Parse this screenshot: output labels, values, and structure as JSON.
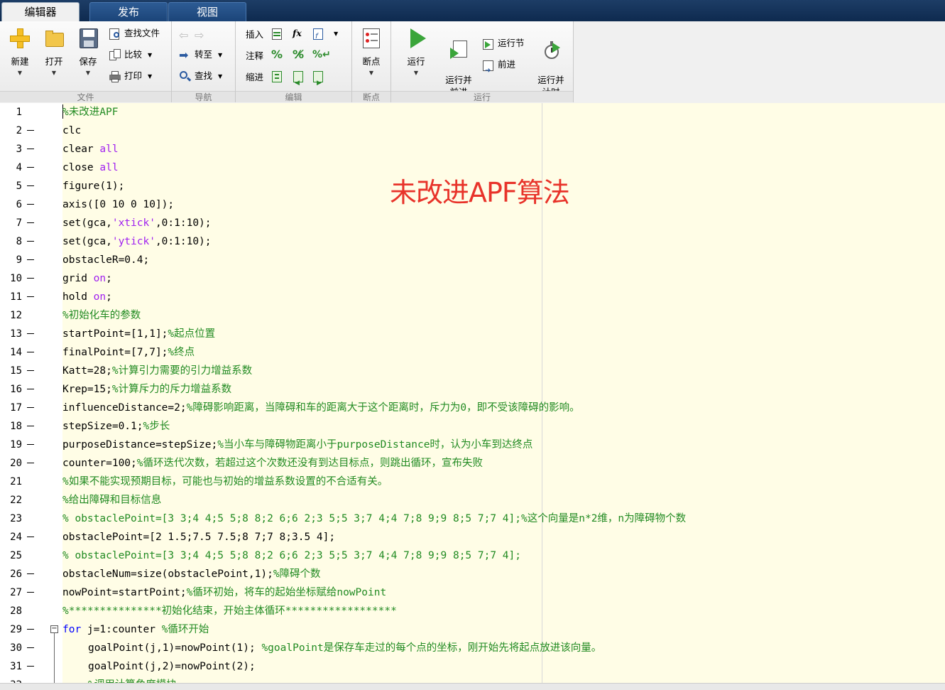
{
  "tabs": [
    {
      "label": "编辑器",
      "active": true
    },
    {
      "label": "发布",
      "active": false
    },
    {
      "label": "视图",
      "active": false
    }
  ],
  "ribbon": {
    "file_group": {
      "label": "文件",
      "new": "新建",
      "open": "打开",
      "save": "保存",
      "find_file": "查找文件",
      "compare": "比较",
      "print": "打印"
    },
    "nav_group": {
      "label": "导航",
      "goto": "转至",
      "find": "查找"
    },
    "edit_group": {
      "label": "编辑",
      "insert": "插入",
      "comment": "注释",
      "indent": "缩进"
    },
    "breakpoint_group": {
      "label": "断点",
      "breakpoints": "断点"
    },
    "run_group": {
      "label": "运行",
      "run": "运行",
      "run_advance": "运行并\n前进",
      "run_section": "运行节",
      "advance": "前进",
      "run_time": "运行并\n计时"
    }
  },
  "overlay_title": "未改进APF算法",
  "lines": [
    {
      "n": "1",
      "dash": false,
      "parts": [
        {
          "t": "%未改进APF",
          "c": "cmt"
        }
      ]
    },
    {
      "n": "2",
      "dash": true,
      "parts": [
        {
          "t": "clc",
          "c": ""
        }
      ]
    },
    {
      "n": "3",
      "dash": true,
      "parts": [
        {
          "t": "clear ",
          "c": ""
        },
        {
          "t": "all",
          "c": "str"
        }
      ]
    },
    {
      "n": "4",
      "dash": true,
      "parts": [
        {
          "t": "close ",
          "c": ""
        },
        {
          "t": "all",
          "c": "str"
        }
      ]
    },
    {
      "n": "5",
      "dash": true,
      "parts": [
        {
          "t": "figure(1);",
          "c": ""
        }
      ]
    },
    {
      "n": "6",
      "dash": true,
      "parts": [
        {
          "t": "axis([0 10 0 10]);",
          "c": ""
        }
      ]
    },
    {
      "n": "7",
      "dash": true,
      "parts": [
        {
          "t": "set(gca,",
          "c": ""
        },
        {
          "t": "'xtick'",
          "c": "str"
        },
        {
          "t": ",0:1:10);",
          "c": ""
        }
      ]
    },
    {
      "n": "8",
      "dash": true,
      "parts": [
        {
          "t": "set(gca,",
          "c": ""
        },
        {
          "t": "'ytick'",
          "c": "str"
        },
        {
          "t": ",0:1:10);",
          "c": ""
        }
      ]
    },
    {
      "n": "9",
      "dash": true,
      "parts": [
        {
          "t": "obstacleR=0.4;",
          "c": ""
        }
      ]
    },
    {
      "n": "10",
      "dash": true,
      "parts": [
        {
          "t": "grid ",
          "c": ""
        },
        {
          "t": "on",
          "c": "str"
        },
        {
          "t": ";",
          "c": ""
        }
      ]
    },
    {
      "n": "11",
      "dash": true,
      "parts": [
        {
          "t": "hold ",
          "c": ""
        },
        {
          "t": "on",
          "c": "str"
        },
        {
          "t": ";",
          "c": ""
        }
      ]
    },
    {
      "n": "12",
      "dash": false,
      "parts": [
        {
          "t": "%初始化车的参数",
          "c": "cmt"
        }
      ]
    },
    {
      "n": "13",
      "dash": true,
      "parts": [
        {
          "t": "startPoint=[1,1];",
          "c": ""
        },
        {
          "t": "%起点位置",
          "c": "cmt"
        }
      ]
    },
    {
      "n": "14",
      "dash": true,
      "parts": [
        {
          "t": "finalPoint=[7,7];",
          "c": ""
        },
        {
          "t": "%终点",
          "c": "cmt"
        }
      ]
    },
    {
      "n": "15",
      "dash": true,
      "parts": [
        {
          "t": "Katt=28;",
          "c": ""
        },
        {
          "t": "%计算引力需要的引力增益系数",
          "c": "cmt"
        }
      ]
    },
    {
      "n": "16",
      "dash": true,
      "parts": [
        {
          "t": "Krep=15;",
          "c": ""
        },
        {
          "t": "%计算斥力的斥力增益系数",
          "c": "cmt"
        }
      ]
    },
    {
      "n": "17",
      "dash": true,
      "parts": [
        {
          "t": "influenceDistance=2;",
          "c": ""
        },
        {
          "t": "%障碍影响距离，当障碍和车的距离大于这个距离时，斥力为0，即不受该障碍的影响。",
          "c": "cmt"
        }
      ]
    },
    {
      "n": "18",
      "dash": true,
      "parts": [
        {
          "t": "stepSize=0.1;",
          "c": ""
        },
        {
          "t": "%步长",
          "c": "cmt"
        }
      ]
    },
    {
      "n": "19",
      "dash": true,
      "parts": [
        {
          "t": "purposeDistance=stepSize;",
          "c": ""
        },
        {
          "t": "%当小车与障碍物距离小于purposeDistance时，认为小车到达终点",
          "c": "cmt"
        }
      ]
    },
    {
      "n": "20",
      "dash": true,
      "parts": [
        {
          "t": "counter=100;",
          "c": ""
        },
        {
          "t": "%循环迭代次数，若超过这个次数还没有到达目标点，则跳出循环，宣布失败",
          "c": "cmt"
        }
      ]
    },
    {
      "n": "21",
      "dash": false,
      "parts": [
        {
          "t": "%如果不能实现预期目标，可能也与初始的增益系数设置的不合适有关。",
          "c": "cmt"
        }
      ]
    },
    {
      "n": "22",
      "dash": false,
      "parts": [
        {
          "t": "%给出障碍和目标信息",
          "c": "cmt"
        }
      ]
    },
    {
      "n": "23",
      "dash": false,
      "parts": [
        {
          "t": "% obstaclePoint=[3 3;4 4;5 5;8 8;2 6;6 2;3 5;5 3;7 4;4 7;8 9;9 8;5 7;7 4];%这个向量是n*2维，n为障碍物个数",
          "c": "cmt"
        }
      ]
    },
    {
      "n": "24",
      "dash": true,
      "parts": [
        {
          "t": "obstaclePoint=[2 1.5;7.5 7.5;8 7;7 8;3.5 4];",
          "c": ""
        }
      ]
    },
    {
      "n": "25",
      "dash": false,
      "parts": [
        {
          "t": "% obstaclePoint=[3 3;4 4;5 5;8 8;2 6;6 2;3 5;5 3;7 4;4 7;8 9;9 8;5 7;7 4];",
          "c": "cmt"
        }
      ]
    },
    {
      "n": "26",
      "dash": true,
      "parts": [
        {
          "t": "obstacleNum=size(obstaclePoint,1);",
          "c": ""
        },
        {
          "t": "%障碍个数",
          "c": "cmt"
        }
      ]
    },
    {
      "n": "27",
      "dash": true,
      "parts": [
        {
          "t": "nowPoint=startPoint;",
          "c": ""
        },
        {
          "t": "%循环初始，将车的起始坐标赋给nowPoint",
          "c": "cmt"
        }
      ]
    },
    {
      "n": "28",
      "dash": false,
      "parts": [
        {
          "t": "%***************初始化结束，开始主体循环******************",
          "c": "cmt"
        }
      ]
    },
    {
      "n": "29",
      "dash": true,
      "fold": true,
      "parts": [
        {
          "t": "for",
          "c": "kw"
        },
        {
          "t": " j=1:counter ",
          "c": ""
        },
        {
          "t": "%循环开始",
          "c": "cmt"
        }
      ]
    },
    {
      "n": "30",
      "dash": true,
      "indent": true,
      "parts": [
        {
          "t": "goalPoint(j,1)=nowPoint(1); ",
          "c": ""
        },
        {
          "t": "%goalPoint是保存车走过的每个点的坐标，刚开始先将起点放进该向量。",
          "c": "cmt"
        }
      ]
    },
    {
      "n": "31",
      "dash": true,
      "indent": true,
      "parts": [
        {
          "t": "goalPoint(j,2)=nowPoint(2);",
          "c": ""
        }
      ]
    },
    {
      "n": "32",
      "dash": false,
      "indent": true,
      "parts": [
        {
          "t": "%调用计算角度模块",
          "c": "cmt"
        }
      ]
    }
  ]
}
